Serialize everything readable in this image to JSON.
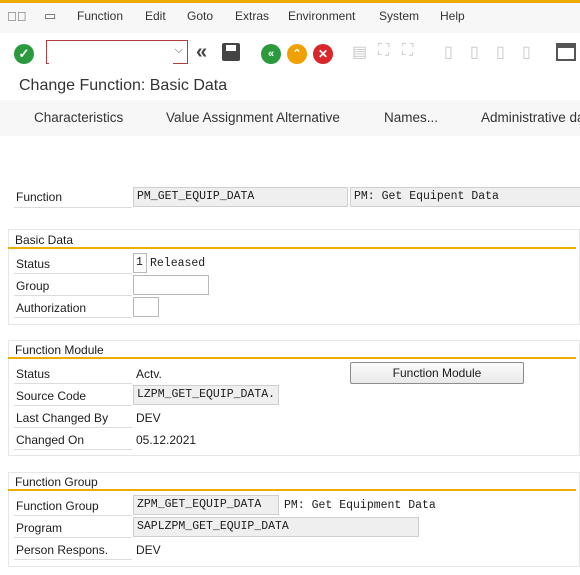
{
  "menu": {
    "items": [
      "Function",
      "Edit",
      "Goto",
      "Extras",
      "Environment",
      "System",
      "Help"
    ]
  },
  "toolbar": {
    "command_value": "",
    "icons": [
      "enter-icon",
      "back-arrows-icon",
      "save-icon",
      "back-icon",
      "exit-icon",
      "cancel-icon",
      "print-icon",
      "find-icon",
      "find-next-icon",
      "first-page-icon",
      "prev-page-icon",
      "next-page-icon",
      "last-page-icon",
      "layout-icon"
    ]
  },
  "title": "Change Function: Basic Data",
  "app_toolbar": {
    "characteristics": "Characteristics",
    "value_assignment": "Value Assignment Alternative",
    "names": "Names...",
    "administrative": "Administrative da"
  },
  "function": {
    "label": "Function",
    "name": "PM_GET_EQUIP_DATA",
    "description": "PM: Get Equipent Data"
  },
  "basic_data": {
    "title": "Basic Data",
    "status_label": "Status",
    "status_code": "1",
    "status_text": "Released",
    "group_label": "Group",
    "group_value": "",
    "authorization_label": "Authorization",
    "authorization_value": ""
  },
  "function_module": {
    "title": "Function Module",
    "status_label": "Status",
    "status_value": "Actv.",
    "button_label": "Function Module",
    "source_code_label": "Source Code",
    "source_code_value": "LZPM_GET_EQUIP_DATA.",
    "last_changed_by_label": "Last Changed By",
    "last_changed_by_value": "DEV",
    "changed_on_label": "Changed On",
    "changed_on_value": "05.12.2021"
  },
  "function_group": {
    "title": "Function Group",
    "group_label": "Function Group",
    "group_value": "ZPM_GET_EQUIP_DATA",
    "group_description": "PM: Get Equipment Data",
    "program_label": "Program",
    "program_value": "SAPLZPM_GET_EQUIP_DATA",
    "person_label": "Person Respons.",
    "person_value": "DEV"
  },
  "colors": {
    "accent": "#f0ab00",
    "enter_green": "#2b9a3e",
    "back_green": "#2b9a3e",
    "exit_orange": "#f0a000",
    "cancel_red": "#d9262b"
  }
}
